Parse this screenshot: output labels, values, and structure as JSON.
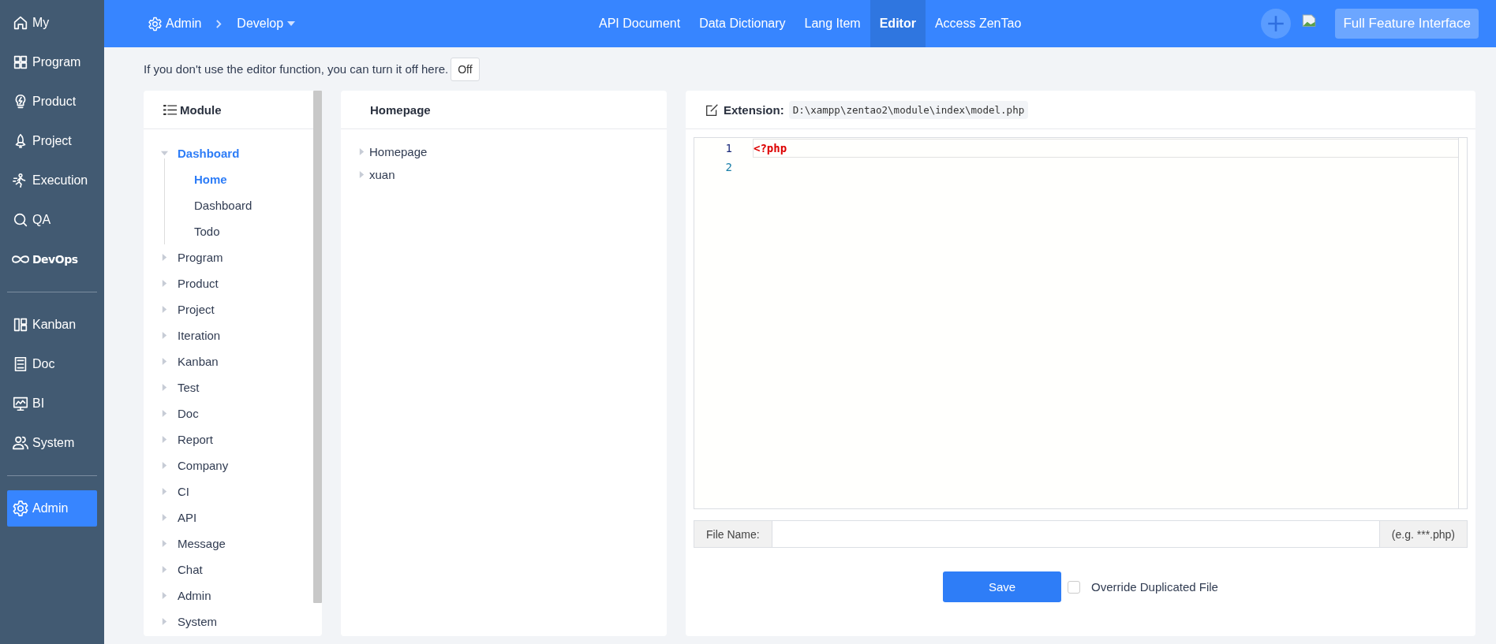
{
  "sidebar": {
    "groups": [
      [
        {
          "label": "My",
          "selected": false
        },
        {
          "label": "Program",
          "selected": false
        },
        {
          "label": "Product",
          "selected": false
        },
        {
          "label": "Project",
          "selected": false
        },
        {
          "label": "Execution",
          "selected": false
        },
        {
          "label": "QA",
          "selected": false
        },
        {
          "label": "DevOps",
          "selected": false
        }
      ],
      [
        {
          "label": "Kanban",
          "selected": false
        },
        {
          "label": "Doc",
          "selected": false
        },
        {
          "label": "BI",
          "selected": false
        },
        {
          "label": "System",
          "selected": false
        }
      ],
      [
        {
          "label": "Admin",
          "selected": true
        }
      ]
    ]
  },
  "header": {
    "breadcrumb": {
      "app": "Admin",
      "section": "Develop"
    },
    "tabs": [
      {
        "label": "API Document",
        "selected": false
      },
      {
        "label": "Data Dictionary",
        "selected": false
      },
      {
        "label": "Lang Item",
        "selected": false
      },
      {
        "label": "Editor",
        "selected": true
      },
      {
        "label": "Access ZenTao",
        "selected": false
      }
    ],
    "button": "Full Feature Interface"
  },
  "notice": {
    "text": "If you don't use the editor function, you can turn it off here.",
    "button": "Off"
  },
  "module_panel": {
    "title": "Module",
    "tree": [
      {
        "label": "Dashboard",
        "expanded": true,
        "selected": true,
        "children": [
          {
            "label": "Home",
            "selected": true
          },
          {
            "label": "Dashboard",
            "selected": false
          },
          {
            "label": "Todo",
            "selected": false
          }
        ]
      },
      {
        "label": "Program",
        "expanded": false,
        "selected": false
      },
      {
        "label": "Product",
        "expanded": false,
        "selected": false
      },
      {
        "label": "Project",
        "expanded": false,
        "selected": false
      },
      {
        "label": "Iteration",
        "expanded": false,
        "selected": false
      },
      {
        "label": "Kanban",
        "expanded": false,
        "selected": false
      },
      {
        "label": "Test",
        "expanded": false,
        "selected": false
      },
      {
        "label": "Doc",
        "expanded": false,
        "selected": false
      },
      {
        "label": "Report",
        "expanded": false,
        "selected": false
      },
      {
        "label": "Company",
        "expanded": false,
        "selected": false
      },
      {
        "label": "CI",
        "expanded": false,
        "selected": false
      },
      {
        "label": "API",
        "expanded": false,
        "selected": false
      },
      {
        "label": "Message",
        "expanded": false,
        "selected": false
      },
      {
        "label": "Chat",
        "expanded": false,
        "selected": false
      },
      {
        "label": "Admin",
        "expanded": false,
        "selected": false
      },
      {
        "label": "System",
        "expanded": false,
        "selected": false
      }
    ]
  },
  "file_panel": {
    "title": "Homepage",
    "tree": [
      {
        "label": "Homepage",
        "expanded": false,
        "selected": false
      },
      {
        "label": "xuan",
        "expanded": false,
        "selected": false
      }
    ]
  },
  "editor": {
    "label": "Extension:",
    "path": "D:\\xampp\\zentao2\\module\\index\\model.php",
    "lines": [
      {
        "number": "1",
        "text": "<?php",
        "active": true
      },
      {
        "number": "2",
        "active": false
      }
    ],
    "file_name": {
      "label": "File Name:",
      "hint": "(e.g. ***.php)"
    },
    "save": "Save",
    "override": {
      "label": "Override Duplicated File",
      "checked": false
    }
  }
}
